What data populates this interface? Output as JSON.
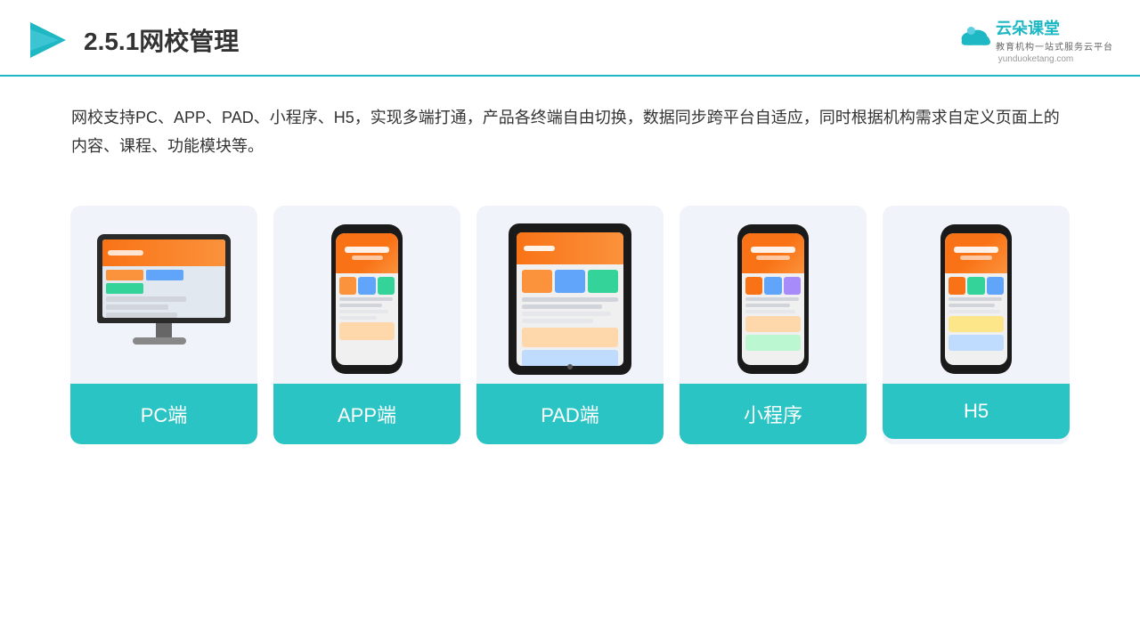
{
  "header": {
    "title": "2.5.1网校管理",
    "brand_name": "云朵课堂",
    "brand_url": "yunduoketang.com",
    "brand_subtitle": "教育机构一站式服务云平台"
  },
  "description": "网校支持PC、APP、PAD、小程序、H5，实现多端打通，产品各终端自由切换，数据同步跨平台自适应，同时根据机构需求自定义页面上的内容、课程、功能模块等。",
  "cards": [
    {
      "id": "pc",
      "label": "PC端",
      "device": "pc"
    },
    {
      "id": "app",
      "label": "APP端",
      "device": "phone"
    },
    {
      "id": "pad",
      "label": "PAD端",
      "device": "tablet"
    },
    {
      "id": "miniprogram",
      "label": "小程序",
      "device": "phone"
    },
    {
      "id": "h5",
      "label": "H5",
      "device": "phone"
    }
  ]
}
